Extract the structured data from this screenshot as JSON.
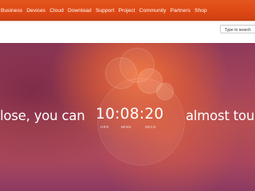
{
  "nav": {
    "items": [
      {
        "label": "Business"
      },
      {
        "label": "Devices"
      },
      {
        "label": "Cloud"
      },
      {
        "label": "Download"
      },
      {
        "label": "Support"
      },
      {
        "label": "Project"
      },
      {
        "label": "Community"
      },
      {
        "label": "Partners"
      },
      {
        "label": "Shop"
      }
    ]
  },
  "search": {
    "placeholder": "Type to search"
  },
  "hero": {
    "left_text": "lose, you can",
    "right_text": "almost touch",
    "countdown": {
      "time": "10:08:20",
      "units": [
        "HRS",
        "MINS",
        "SECS"
      ]
    }
  },
  "colors": {
    "nav_orange": "#dd4814",
    "hero_aubergine": "#a4445a"
  }
}
